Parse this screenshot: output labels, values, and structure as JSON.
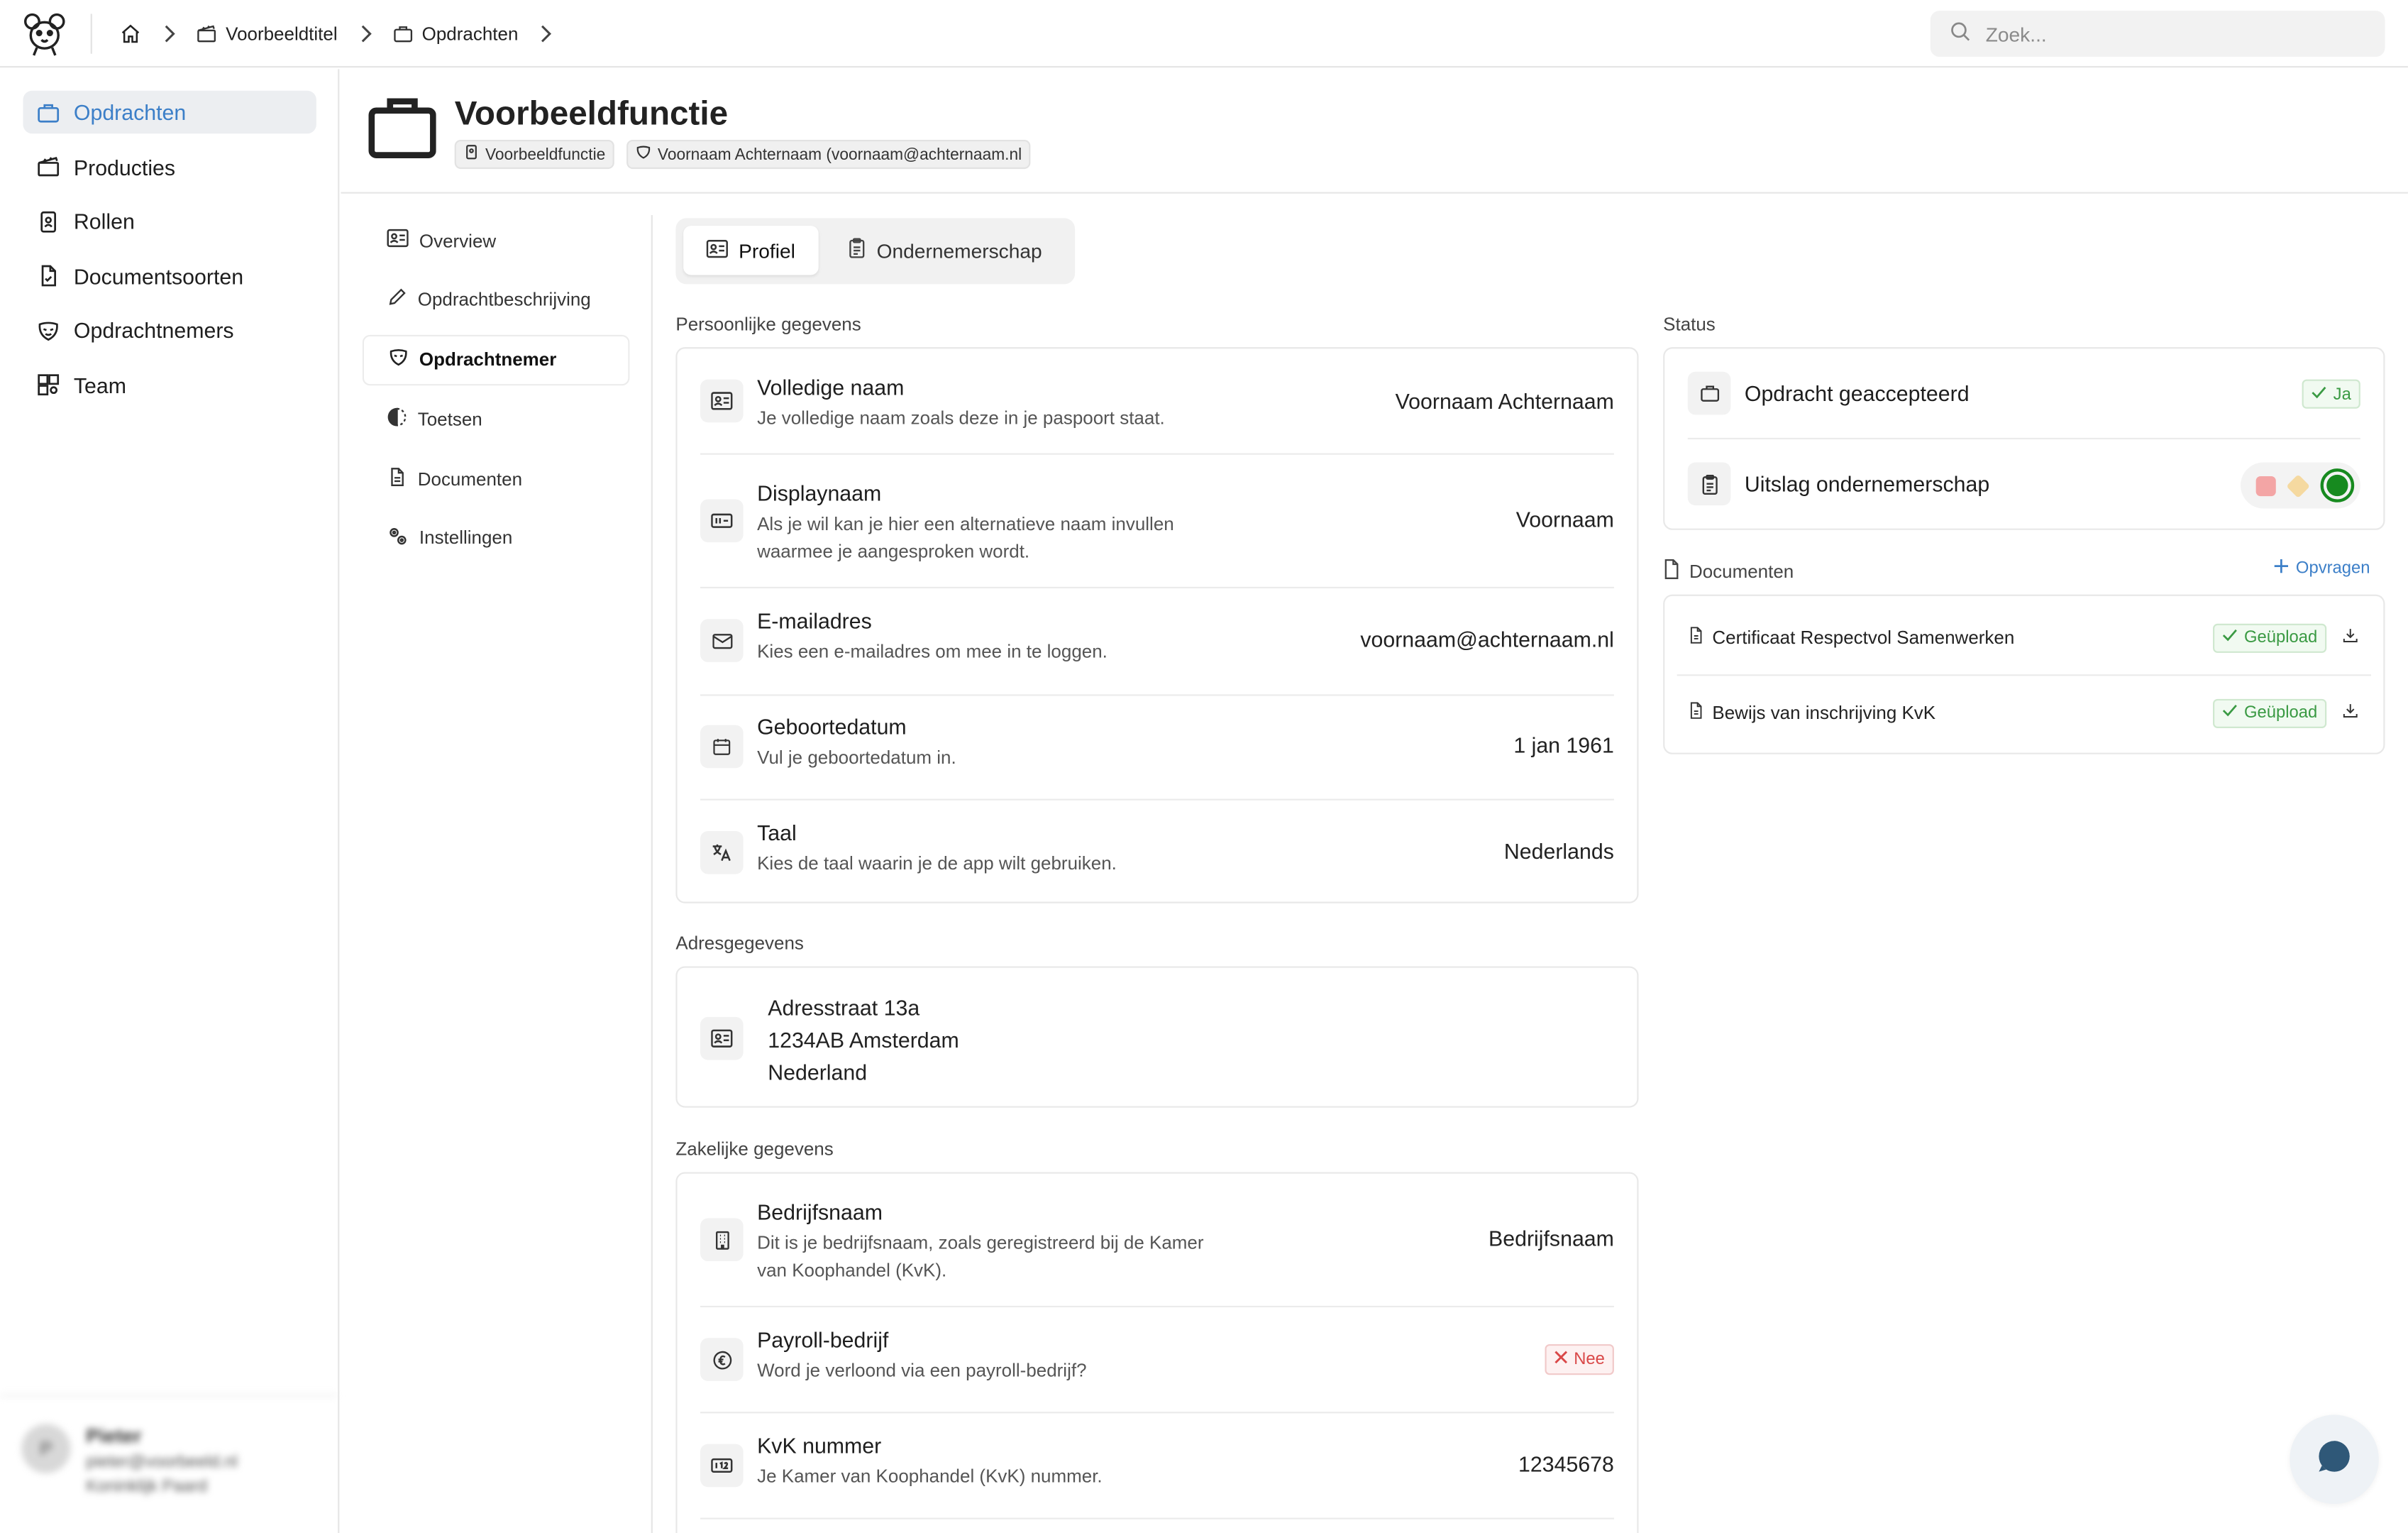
{
  "breadcrumb": [
    {
      "label": "Voorbeeldtitel",
      "icon": "clapperboard-icon"
    },
    {
      "label": "Opdrachten",
      "icon": "briefcase-icon"
    }
  ],
  "search": {
    "placeholder": "Zoek..."
  },
  "sidebar": {
    "items": [
      {
        "label": "Opdrachten",
        "icon": "briefcase-icon",
        "active": true
      },
      {
        "label": "Producties",
        "icon": "clapperboard-icon"
      },
      {
        "label": "Rollen",
        "icon": "badge-icon"
      },
      {
        "label": "Documentsoorten",
        "icon": "file-icon"
      },
      {
        "label": "Opdrachtnemers",
        "icon": "mask-icon"
      },
      {
        "label": "Team",
        "icon": "team-icon"
      }
    ],
    "user": {
      "initial": "P",
      "name": "Pieter",
      "email": "pieter@voorbeeld.nl",
      "role": "Koninklijk Paard"
    }
  },
  "header": {
    "title": "Voorbeeldfunctie",
    "chips": [
      "Voorbeeldfunctie",
      "Voornaam Achternaam (voornaam@achternaam.nl"
    ]
  },
  "subnav": {
    "items": [
      {
        "label": "Overview"
      },
      {
        "label": "Opdrachtbeschrijving"
      },
      {
        "label": "Opdrachtnemer",
        "active": true
      },
      {
        "label": "Toetsen"
      },
      {
        "label": "Documenten"
      },
      {
        "label": "Instellingen"
      }
    ]
  },
  "tabs": [
    {
      "label": "Profiel",
      "active": true
    },
    {
      "label": "Ondernemerschap"
    }
  ],
  "personal": {
    "label": "Persoonlijke gegevens",
    "rows": [
      {
        "title": "Volledige naam",
        "desc": "Je volledige naam zoals deze in je paspoort staat.",
        "value": "Voornaam Achternaam"
      },
      {
        "title": "Displaynaam",
        "desc": "Als je wil kan je hier een alternatieve naam invullen waarmee je aangesproken wordt.",
        "value": "Voornaam"
      },
      {
        "title": "E-mailadres",
        "desc": "Kies een e-mailadres om mee in te loggen.",
        "value": "voornaam@achternaam.nl"
      },
      {
        "title": "Geboortedatum",
        "desc": "Vul je geboortedatum in.",
        "value": "1 jan 1961"
      },
      {
        "title": "Taal",
        "desc": "Kies de taal waarin je de app wilt gebruiken.",
        "value": "Nederlands"
      }
    ]
  },
  "address": {
    "label": "Adresgegevens",
    "lines": [
      "Adresstraat 13a",
      "1234AB Amsterdam",
      "Nederland"
    ]
  },
  "business": {
    "label": "Zakelijke gegevens",
    "rows": [
      {
        "title": "Bedrijfsnaam",
        "desc": "Dit is je bedrijfsnaam, zoals geregistreerd bij de Kamer van Koophandel (KvK).",
        "value": "Bedrijfsnaam"
      },
      {
        "title": "Payroll-bedrijf",
        "desc": "Word je verloond via een payroll-bedrijf?",
        "badge": "Nee"
      },
      {
        "title": "KvK nummer",
        "desc": "Je Kamer van Koophandel (KvK) nummer.",
        "value": "12345678"
      }
    ]
  },
  "status": {
    "label": "Status",
    "rows": [
      {
        "title": "Opdracht geaccepteerd",
        "badge": "Ja"
      },
      {
        "title": "Uitslag ondernemerschap",
        "result": "green"
      }
    ]
  },
  "documents": {
    "label": "Documenten",
    "request_label": "Opvragen",
    "items": [
      {
        "name": "Certificaat Respectvol Samenwerken",
        "status": "Geüpload"
      },
      {
        "name": "Bewijs van inschrijving KvK",
        "status": "Geüpload"
      }
    ]
  },
  "colors": {
    "accent": "#3c7fc8",
    "success": "#178a1f",
    "danger": "#d94848"
  }
}
